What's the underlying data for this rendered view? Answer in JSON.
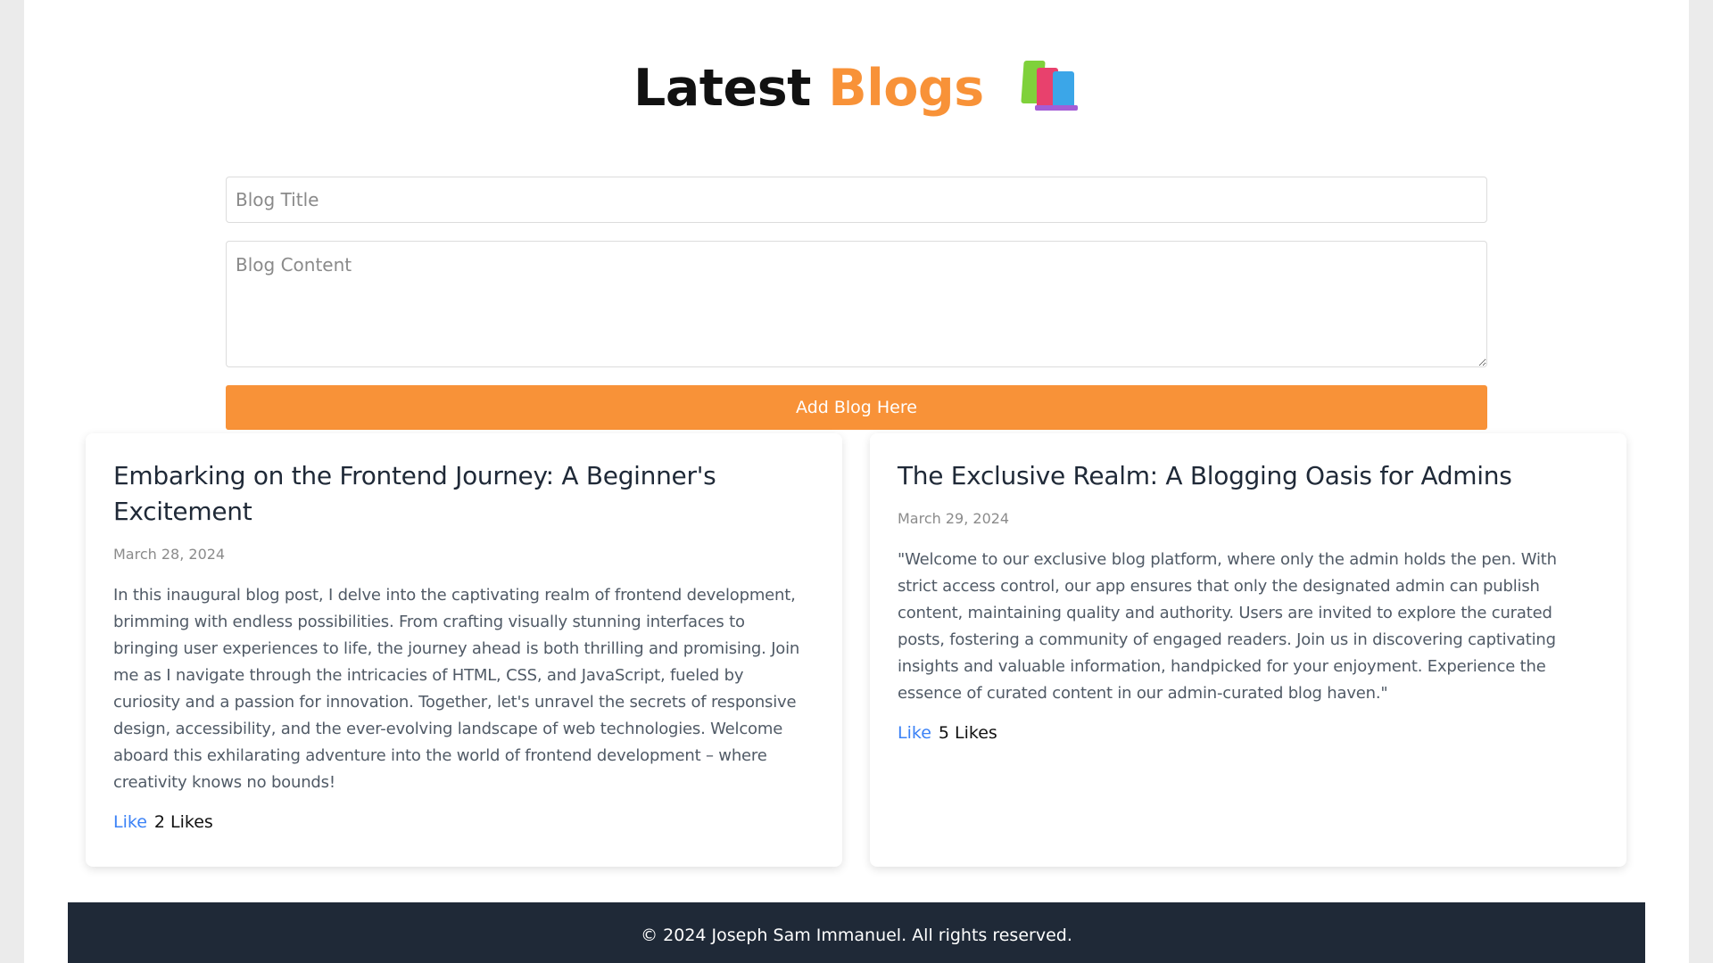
{
  "header": {
    "title_part1": "Latest",
    "title_part2": "Blogs",
    "icon": "books-icon",
    "accent_color": "#f89238"
  },
  "form": {
    "title_placeholder": "Blog Title",
    "title_value": "",
    "content_placeholder": "Blog Content",
    "content_value": "",
    "submit_label": "Add Blog Here",
    "submit_color": "#f89238"
  },
  "posts": [
    {
      "title": "Embarking on the Frontend Journey: A Beginner's Excitement",
      "date": "March 28, 2024",
      "body": "In this inaugural blog post, I delve into the captivating realm of frontend development, brimming with endless possibilities. From crafting visually stunning interfaces to bringing user experiences to life, the journey ahead is both thrilling and promising. Join me as I navigate through the intricacies of HTML, CSS, and JavaScript, fueled by curiosity and a passion for innovation. Together, let's unravel the secrets of responsive design, accessibility, and the ever-evolving landscape of web technologies. Welcome aboard this exhilarating adventure into the world of frontend development – where creativity knows no bounds!",
      "like_label": "Like",
      "likes_text": "2 Likes"
    },
    {
      "title": "The Exclusive Realm: A Blogging Oasis for Admins",
      "date": "March 29, 2024",
      "body": "\"Welcome to our exclusive blog platform, where only the admin holds the pen. With strict access control, our app ensures that only the designated admin can publish content, maintaining quality and authority. Users are invited to explore the curated posts, fostering a community of engaged readers. Join us in discovering captivating insights and valuable information, handpicked for your enjoyment. Experience the essence of curated content in our admin-curated blog haven.\"",
      "like_label": "Like",
      "likes_text": "5 Likes"
    }
  ],
  "footer": {
    "text": "© 2024 Joseph Sam Immanuel. All rights reserved.",
    "background": "#1f2937"
  },
  "colors": {
    "link": "#3b82f6",
    "page_background": "#ebebeb"
  }
}
